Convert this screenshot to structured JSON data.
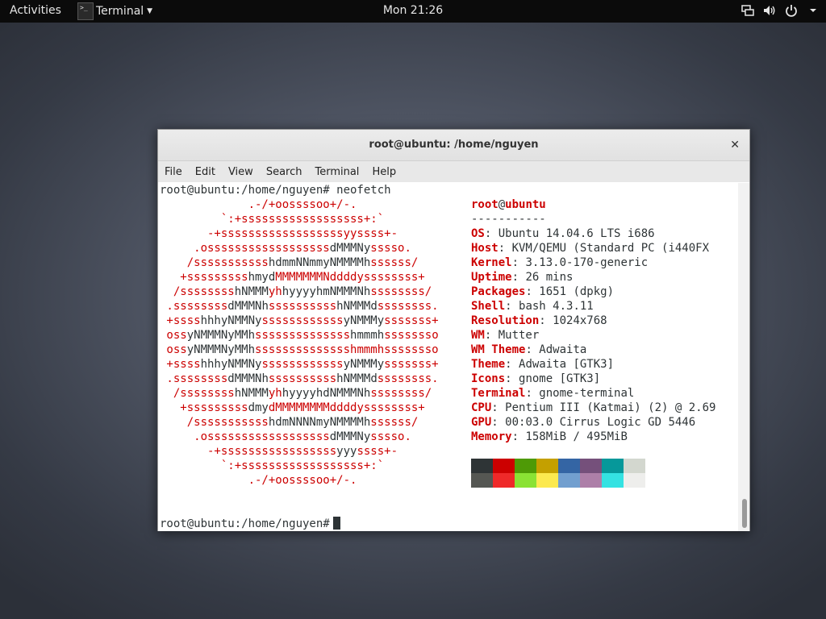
{
  "topbar": {
    "activities": "Activities",
    "app_name": "Terminal",
    "clock": "Mon 21:26"
  },
  "window": {
    "title": "root@ubuntu: /home/nguyen",
    "menu": [
      "File",
      "Edit",
      "View",
      "Search",
      "Terminal",
      "Help"
    ]
  },
  "terminal": {
    "command_line": "root@ubuntu:/home/nguyen# neofetch",
    "logo": [
      [
        [
          "r",
          "             .-/+oossssoo+/-."
        ]
      ],
      [
        [
          "r",
          "         `:+ssssssssssssssssss+:`"
        ]
      ],
      [
        [
          "r",
          "       -+ssssssssssssssssssyyssss+-"
        ]
      ],
      [
        [
          "r",
          "     .ossssssssssssssssss"
        ],
        [
          "k",
          "dMMMNy"
        ],
        [
          "r",
          "sssso."
        ]
      ],
      [
        [
          "r",
          "    /sssssssssss"
        ],
        [
          "k",
          "hdmmNNmmyNMMMMh"
        ],
        [
          "r",
          "ssssss/"
        ]
      ],
      [
        [
          "r",
          "   +sssssssss"
        ],
        [
          "k",
          "hmyd"
        ],
        [
          "r",
          "MMMMMMMNddddyssssssss+"
        ]
      ],
      [
        [
          "r",
          "  /ssssssss"
        ],
        [
          "k",
          "hNMMM"
        ],
        [
          "r",
          "yh"
        ],
        [
          "k",
          "hyyyyhmNMMMNh"
        ],
        [
          "r",
          "ssssssss/"
        ]
      ],
      [
        [
          "r",
          " .ssssssss"
        ],
        [
          "k",
          "dMMMNh"
        ],
        [
          "r",
          "ssssssssss"
        ],
        [
          "k",
          "hNMMMd"
        ],
        [
          "r",
          "ssssssss."
        ]
      ],
      [
        [
          "r",
          " +ssss"
        ],
        [
          "k",
          "hhhyNMMNy"
        ],
        [
          "r",
          "ssssssssssss"
        ],
        [
          "k",
          "yNMMMy"
        ],
        [
          "r",
          "sssssss+"
        ]
      ],
      [
        [
          "r",
          " oss"
        ],
        [
          "k",
          "yNMMMNyMMh"
        ],
        [
          "r",
          "ssssssssssssss"
        ],
        [
          "k",
          "hmmmh"
        ],
        [
          "r",
          "ssssssso"
        ]
      ],
      [
        [
          "r",
          " oss"
        ],
        [
          "k",
          "yNMMMNyMMh"
        ],
        [
          "r",
          "sssssssssssssshmmmhssssssso"
        ]
      ],
      [
        [
          "r",
          " +ssss"
        ],
        [
          "k",
          "hhhyNMMNy"
        ],
        [
          "r",
          "ssssssssssss"
        ],
        [
          "k",
          "yNMMMy"
        ],
        [
          "r",
          "sssssss+"
        ]
      ],
      [
        [
          "r",
          " .ssssssss"
        ],
        [
          "k",
          "dMMMNh"
        ],
        [
          "r",
          "ssssssssss"
        ],
        [
          "k",
          "hNMMMd"
        ],
        [
          "r",
          "ssssssss."
        ]
      ],
      [
        [
          "r",
          "  /ssssssss"
        ],
        [
          "k",
          "hNMMM"
        ],
        [
          "r",
          "yh"
        ],
        [
          "k",
          "hyyyyhdNMMMNh"
        ],
        [
          "r",
          "ssssssss/"
        ]
      ],
      [
        [
          "r",
          "   +sssssssss"
        ],
        [
          "k",
          "dmy"
        ],
        [
          "r",
          "dMMMMMMMMddddyssssssss+"
        ]
      ],
      [
        [
          "r",
          "    /sssssssssss"
        ],
        [
          "k",
          "hdmNNNNmyNMMMMh"
        ],
        [
          "r",
          "ssssss/"
        ]
      ],
      [
        [
          "r",
          "     .ossssssssssssssssss"
        ],
        [
          "k",
          "dMMMNy"
        ],
        [
          "r",
          "sssso."
        ]
      ],
      [
        [
          "r",
          "       -+sssssssssssssssss"
        ],
        [
          "k",
          "yyy"
        ],
        [
          "r",
          "ssss+-"
        ]
      ],
      [
        [
          "r",
          "         `:+ssssssssssssssssss+:`"
        ]
      ],
      [
        [
          "r",
          "             .-/+oossssoo+/-."
        ]
      ]
    ],
    "user": "root",
    "at": "@",
    "host": "ubuntu",
    "separator": "-----------",
    "info": [
      {
        "label": "OS",
        "value": "Ubuntu 14.04.6 LTS i686"
      },
      {
        "label": "Host",
        "value": "KVM/QEMU (Standard PC (i440FX"
      },
      {
        "label": "Kernel",
        "value": "3.13.0-170-generic"
      },
      {
        "label": "Uptime",
        "value": "26 mins"
      },
      {
        "label": "Packages",
        "value": "1651 (dpkg)"
      },
      {
        "label": "Shell",
        "value": "bash 4.3.11"
      },
      {
        "label": "Resolution",
        "value": "1024x768"
      },
      {
        "label": "WM",
        "value": "Mutter"
      },
      {
        "label": "WM Theme",
        "value": "Adwaita"
      },
      {
        "label": "Theme",
        "value": "Adwaita [GTK3]"
      },
      {
        "label": "Icons",
        "value": "gnome [GTK3]"
      },
      {
        "label": "Terminal",
        "value": "gnome-terminal"
      },
      {
        "label": "CPU",
        "value": "Pentium III (Katmai) (2) @ 2.69"
      },
      {
        "label": "GPU",
        "value": "00:03.0 Cirrus Logic GD 5446"
      },
      {
        "label": "Memory",
        "value": "158MiB / 495MiB"
      }
    ],
    "palette_row1": [
      "#2e3436",
      "#cc0000",
      "#4e9a06",
      "#c4a000",
      "#3465a4",
      "#75507b",
      "#06989a",
      "#d3d7cf"
    ],
    "palette_row2": [
      "#555753",
      "#ef2929",
      "#8ae234",
      "#fce94f",
      "#729fcf",
      "#ad7fa8",
      "#34e2e2",
      "#eeeeec"
    ],
    "final_prompt": "root@ubuntu:/home/nguyen#"
  },
  "icons": {
    "network": "network-wired-icon",
    "volume": "volume-icon",
    "power": "power-icon",
    "dropdown": "chevron-down-icon",
    "close": "close-icon"
  }
}
